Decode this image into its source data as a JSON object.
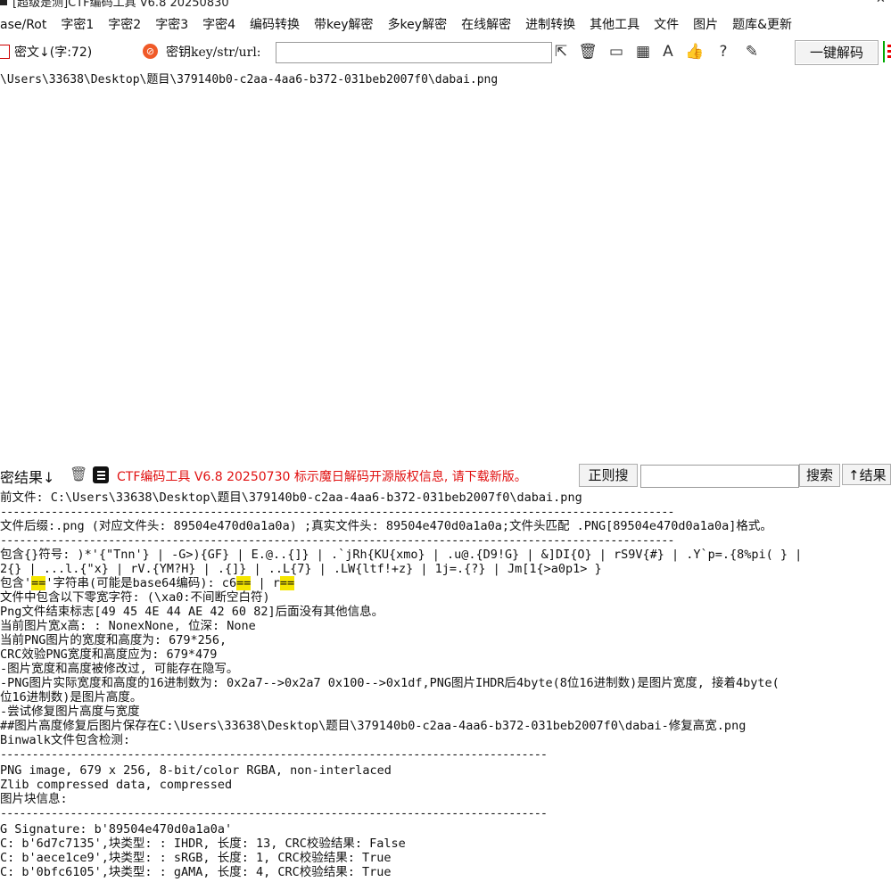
{
  "window": {
    "title": "[超级是测]CTF编码工具 V6.8 20250830",
    "minimize_glyph": "–",
    "close_glyph": "✕"
  },
  "menu": [
    "ase/Rot",
    "字密1",
    "字密2",
    "字密3",
    "字密4",
    "编码转换",
    "带key解密",
    "多key解密",
    "在线解密",
    "进制转换",
    "其他工具",
    "文件",
    "图片",
    "题库&更新"
  ],
  "toolbar": {
    "cipher_label": "密文↓(字:72)",
    "key_label": "密钥key/str/url:",
    "key_value": "",
    "decode_button": "一键解码"
  },
  "input_text": "\\Users\\33638\\Desktop\\题目\\379140b0-c2aa-4aa6-b372-031beb2007f0\\dabai.png",
  "result_bar": {
    "label": "密结果↓",
    "ad_text": "CTF编码工具 V6.8 20250730 标示魔日解码开源版权信息, 请下载新版。",
    "regex_button": "正则搜",
    "search_value": "",
    "search_button": "搜索",
    "result_button": "↑结果"
  },
  "output": {
    "l1": "前文件: C:\\Users\\33638\\Desktop\\题目\\379140b0-c2aa-4aa6-b372-031beb2007f0\\dabai.png",
    "sep1": "----------------------------------------------------------------------------------------------------------",
    "l2": "文件后缀:.png (对应文件头: 89504e470d0a1a0a) ;真实文件头: 89504e470d0a1a0a;文件头匹配 .PNG[89504e470d0a1a0a]格式。",
    "sep2": "----------------------------------------------------------------------------------------------------------",
    "l3": "包含{}符号: )*'{\"Tnn'} | -G>){GF} | E.@..{]} | .`jRh{KU{xmo} | .u@.{D9!G} | &]DI{O} | rS9V{#} | .Y`p=.{8%pi( } |",
    "l4": "2{} | ...l.{\"x} | rV.{YM?H} | .{]} | ..L{7} | .LW{ltf!+z} | 1j=.{?} | Jm[1{>a0p1> }",
    "l5a": "包含'",
    "l5b": "==",
    "l5c": "'字符串(可能是base64编码): c6",
    "l5d": "==",
    "l5e": " | r",
    "l5f": "==",
    "l6": "文件中包含以下零宽字符: (\\xa0:不间断空白符)",
    "l7": "Png文件结束标志[49 45 4E 44 AE 42 60 82]后面没有其他信息。",
    "l8": "当前图片宽x高: : NonexNone, 位深: None",
    "l9": "当前PNG图片的宽度和高度为: 679*256,",
    "l10": "CRC效验PNG宽度和高度应为: 679*479",
    "l11": "-图片宽度和高度被修改过, 可能存在隐写。",
    "l12": "-PNG图片实际宽度和高度的16进制数为: 0x2a7-->0x2a7 0x100-->0x1df,PNG图片IHDR后4byte(8位16进制数)是图片宽度, 接着4byte(",
    "l13": "位16进制数)是图片高度。",
    "l14": "-尝试修复图片高度与宽度",
    "l15": "##图片高度修复后图片保存在C:\\Users\\33638\\Desktop\\题目\\379140b0-c2aa-4aa6-b372-031beb2007f0\\dabai-修复高宽.png",
    "l16": "Binwalk文件包含检测:",
    "sep3": "--------------------------------------------------------------------------------------",
    "l17": "PNG image, 679 x 256, 8-bit/color RGBA, non-interlaced",
    "l18": "Zlib compressed data, compressed",
    "l19": "图片块信息:",
    "sep4": "--------------------------------------------------------------------------------------",
    "l20": "G Signature: b'89504e470d0a1a0a'",
    "l21": "C: b'6d7c7135',块类型: : IHDR, 长度: 13, CRC校验结果: False",
    "l22": "C: b'aece1ce9',块类型: : sRGB, 长度: 1, CRC校验结果: True",
    "l23": "C: b'0bfc6105',块类型: : gAMA, 长度: 4, CRC校验结果: True"
  }
}
